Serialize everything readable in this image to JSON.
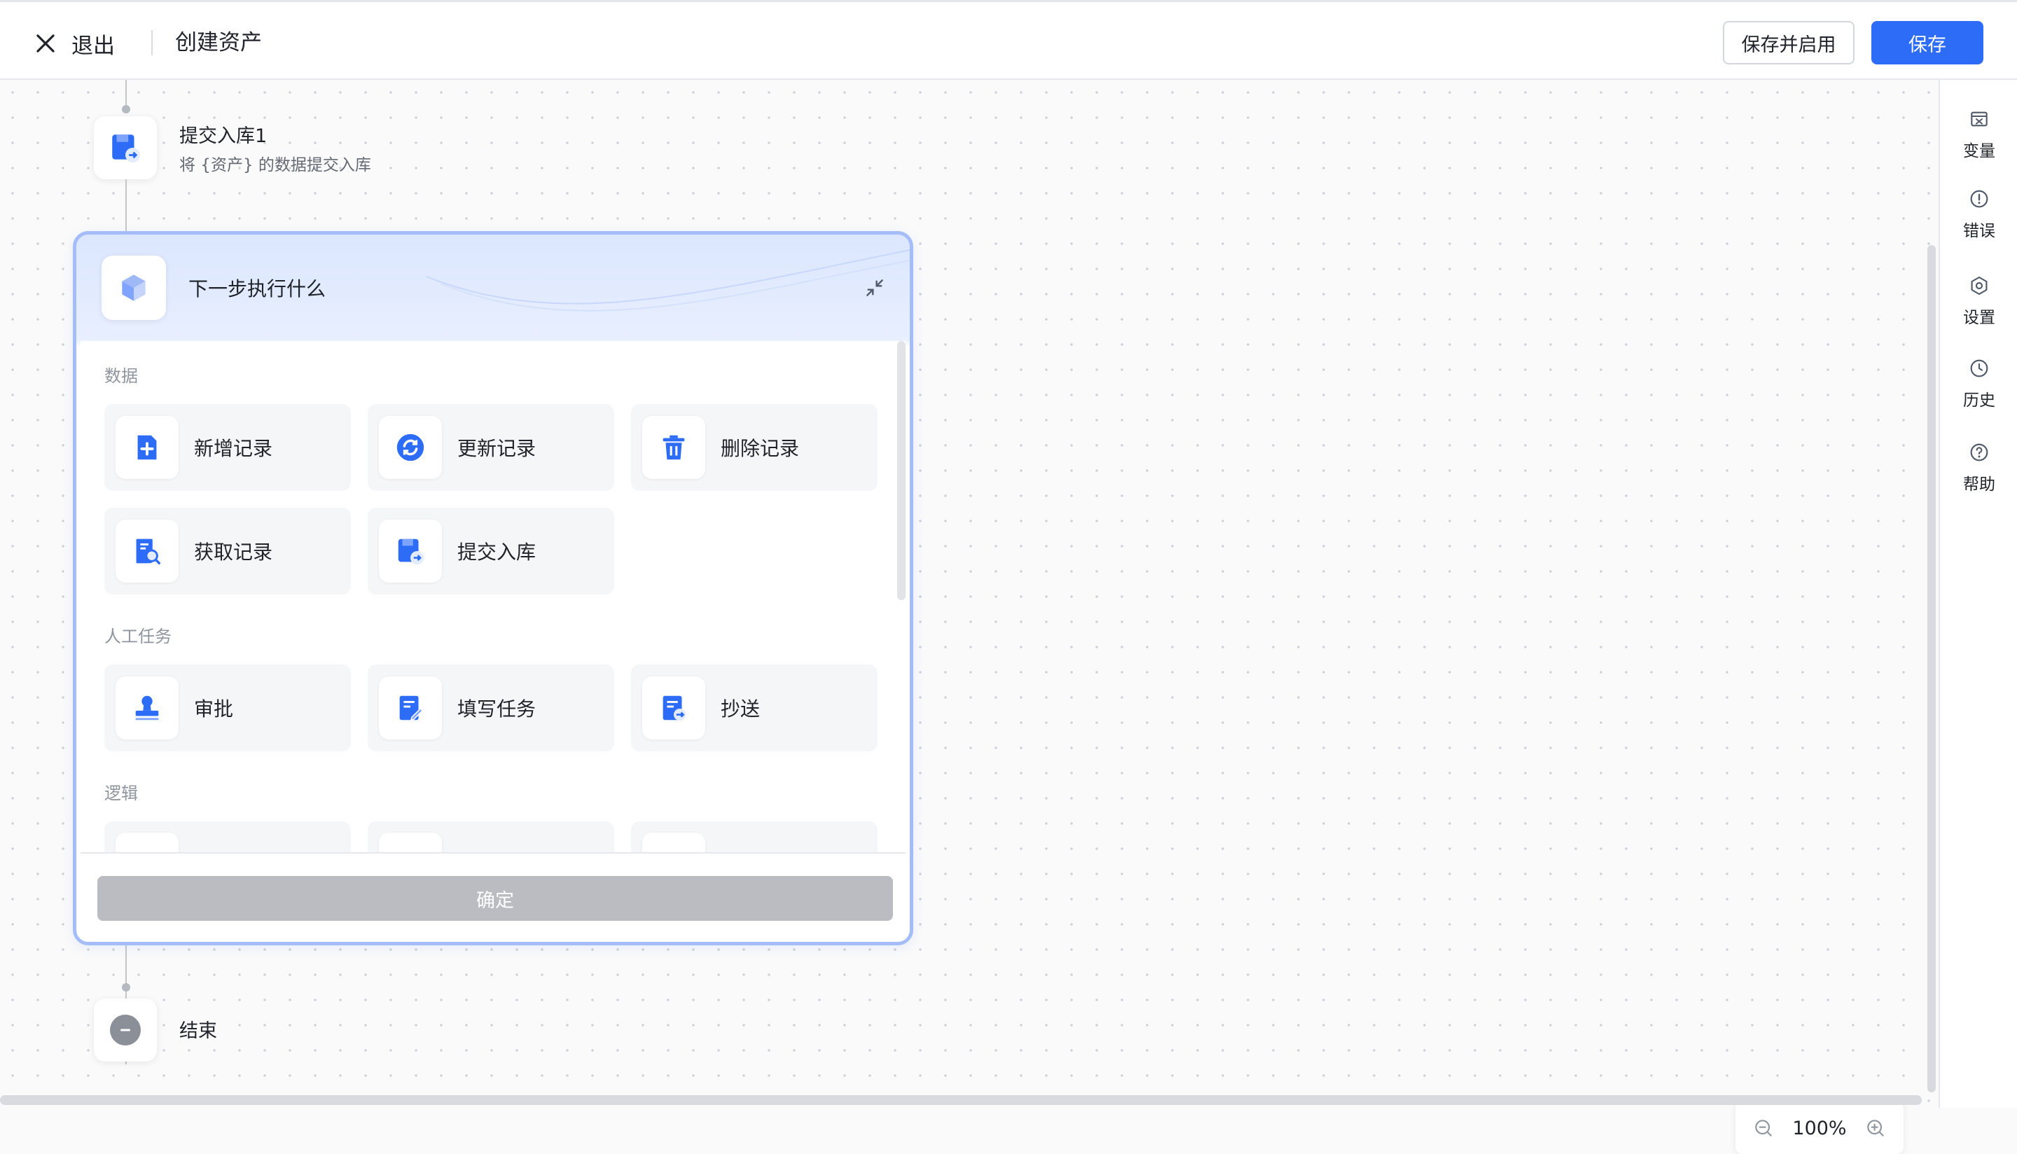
{
  "header": {
    "exit_label": "退出",
    "page_title": "创建资产",
    "save_enable_label": "保存并启用",
    "save_label": "保存"
  },
  "flow": {
    "submit_node": {
      "title": "提交入库1",
      "subtitle": "将 {资产} 的数据提交入库"
    },
    "end_node": {
      "title": "结束"
    }
  },
  "panel": {
    "title": "下一步执行什么",
    "sections": [
      {
        "label": "数据",
        "items": [
          "新增记录",
          "更新记录",
          "删除记录",
          "获取记录",
          "提交入库"
        ]
      },
      {
        "label": "人工任务",
        "items": [
          "审批",
          "填写任务",
          "抄送"
        ]
      },
      {
        "label": "逻辑",
        "items": []
      }
    ],
    "confirm_label": "确定"
  },
  "zoom": {
    "value": "100%"
  },
  "sidebar": {
    "items": [
      {
        "label": "变量",
        "icon": "variable-icon"
      },
      {
        "label": "错误",
        "icon": "error-icon"
      },
      {
        "label": "设置",
        "icon": "settings-icon"
      },
      {
        "label": "历史",
        "icon": "history-icon"
      },
      {
        "label": "帮助",
        "icon": "help-icon"
      }
    ]
  },
  "colors": {
    "primary": "#2d6cf6",
    "panel_border": "#a4bcf8",
    "disabled_button": "#babcc1"
  }
}
